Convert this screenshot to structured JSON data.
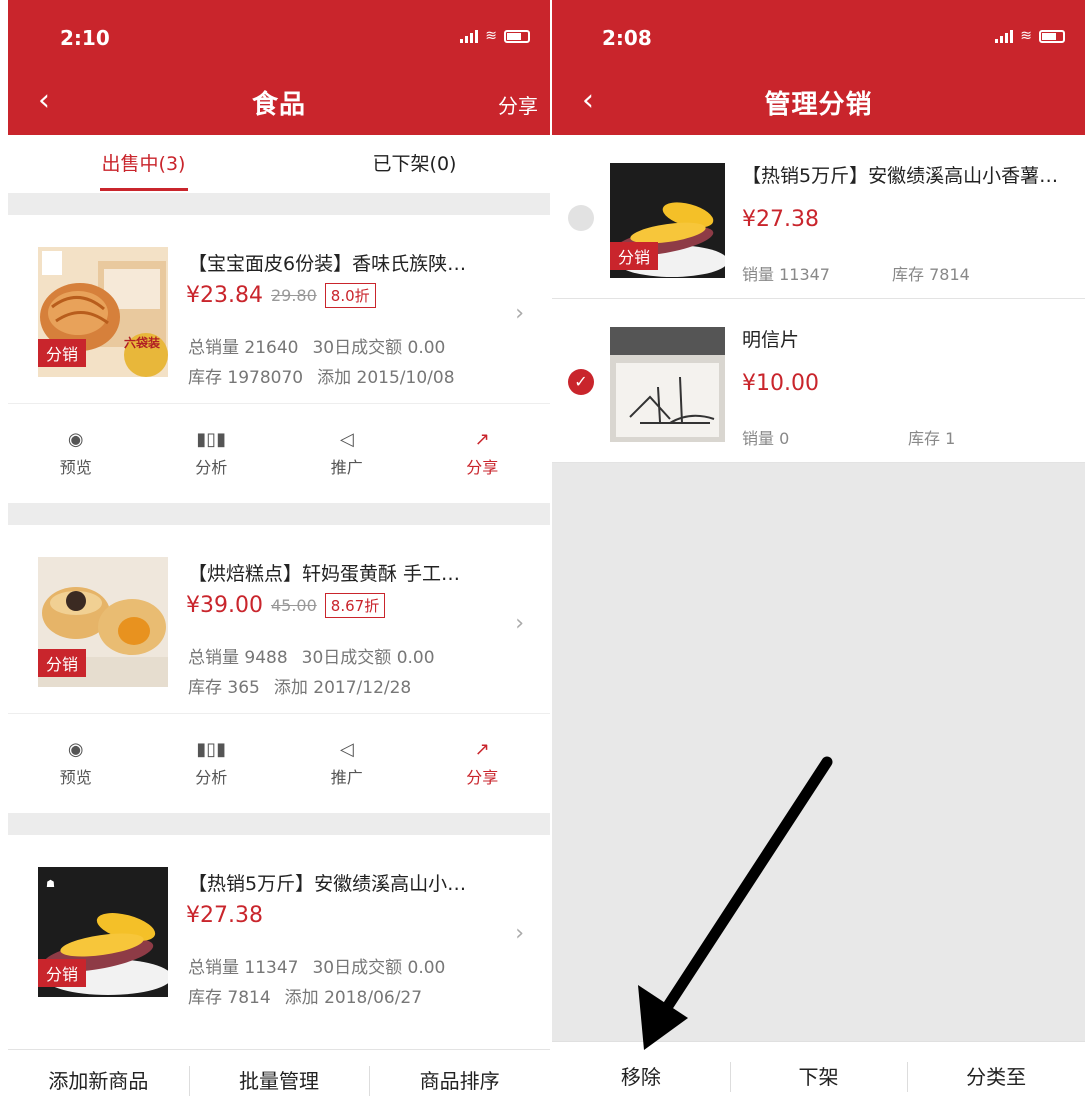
{
  "left": {
    "status_time": "2:10",
    "nav": {
      "back_icon": "chevron-left-icon",
      "title": "食品",
      "share": "分享"
    },
    "tabs": [
      {
        "label": "出售中(3)",
        "active": true
      },
      {
        "label": "已下架(0)",
        "active": false
      }
    ],
    "products": [
      {
        "title": "【宝宝面皮6份装】香味氏族陕…",
        "price": "¥23.84",
        "original_price": "29.80",
        "discount": "8.0折",
        "tag": "分销",
        "total_sales": "总销量 21640",
        "monthly": "30日成交额 0.00",
        "stock": "库存 1978070",
        "added": "添加 2015/10/08",
        "thumb_badge": "六袋装"
      },
      {
        "title": "【烘焙糕点】轩妈蛋黄酥 手工…",
        "price": "¥39.00",
        "original_price": "45.00",
        "discount": "8.67折",
        "tag": "分销",
        "total_sales": "总销量 9488",
        "monthly": "30日成交额 0.00",
        "stock": "库存 365",
        "added": "添加 2017/12/28"
      },
      {
        "title": "【热销5万斤】安徽绩溪高山小…",
        "price": "¥27.38",
        "tag": "分销",
        "total_sales": "总销量 11347",
        "monthly": "30日成交额 0.00",
        "stock": "库存 7814",
        "added": "添加 2018/06/27"
      }
    ],
    "actions": [
      {
        "label": "预览",
        "icon": "eye-icon"
      },
      {
        "label": "分析",
        "icon": "bar-chart-icon"
      },
      {
        "label": "推广",
        "icon": "megaphone-icon"
      },
      {
        "label": "分享",
        "icon": "share-icon"
      }
    ],
    "bottom_bar": [
      "添加新商品",
      "批量管理",
      "商品排序"
    ]
  },
  "right": {
    "status_time": "2:08",
    "nav": {
      "back_icon": "chevron-left-icon",
      "title": "管理分销"
    },
    "items": [
      {
        "title": "【热销5万斤】安徽绩溪高山小香薯…",
        "price": "¥27.38",
        "sales": "销量 11347",
        "stock": "库存 7814",
        "tag": "分销",
        "checked": false
      },
      {
        "title": "明信片",
        "price": "¥10.00",
        "sales": "销量 0",
        "stock": "库存 1",
        "checked": true
      }
    ],
    "bottom_bar": [
      "移除",
      "下架",
      "分类至"
    ]
  },
  "colors": {
    "brand_red": "#c9252c",
    "arrow": "#000000"
  }
}
